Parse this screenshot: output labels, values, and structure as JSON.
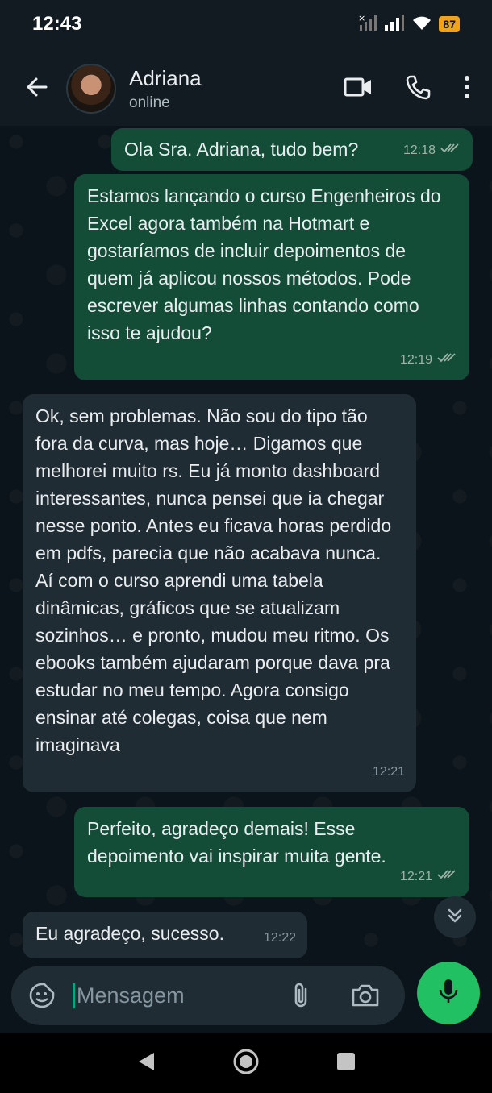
{
  "status_bar": {
    "time": "12:43",
    "battery": "87",
    "icons": [
      "no-signal-icon",
      "signal-icon",
      "wifi-icon",
      "battery-icon"
    ]
  },
  "header": {
    "contact_name": "Adriana",
    "contact_status": "online",
    "icons": [
      "back-arrow-icon",
      "video-call-icon",
      "phone-icon",
      "more-vert-icon"
    ]
  },
  "messages": [
    {
      "direction": "out",
      "text": "Ola Sra. Adriana, tudo bem?",
      "time": "12:18",
      "read": true
    },
    {
      "direction": "out",
      "text": "Estamos lançando o curso Engenheiros do Excel agora também na Hotmart e gostaríamos de incluir depoimentos de quem já aplicou nossos métodos. Pode escrever algumas linhas contando como isso te ajudou?",
      "time": "12:19",
      "read": true
    },
    {
      "direction": "in",
      "text": "Ok, sem problemas. Não sou do tipo tão fora da curva, mas hoje… Digamos que melhorei muito rs. Eu já monto dashboard interessantes, nunca pensei que ia chegar nesse ponto. Antes eu ficava horas perdido em pdfs, parecia que não acabava nunca. Aí com o curso aprendi uma tabela dinâmicas, gráficos que se atualizam sozinhos… e pronto, mudou meu ritmo. Os ebooks também ajudaram porque dava pra estudar no meu tempo. Agora consigo ensinar até colegas, coisa que nem imaginava",
      "time": "12:21",
      "read": false
    },
    {
      "direction": "out",
      "text": "Perfeito, agradeço demais! Esse depoimento vai inspirar muita gente.",
      "time": "12:21",
      "read": true
    },
    {
      "direction": "in",
      "text": "Eu agradeço, sucesso.",
      "time": "12:22",
      "read": false
    }
  ],
  "composer": {
    "placeholder": "Mensagem",
    "icons": [
      "sticker-icon",
      "paperclip-icon",
      "camera-icon",
      "mic-icon"
    ]
  },
  "scroll_down": {
    "icon": "double-chevron-down-icon"
  },
  "nav_bar": {
    "icons": [
      "back-triangle-icon",
      "home-circle-icon",
      "recents-square-icon"
    ]
  },
  "colors": {
    "outgoing_bubble": "#144d37",
    "incoming_bubble": "#202c33",
    "accent": "#21c063",
    "background": "#0b141a"
  }
}
